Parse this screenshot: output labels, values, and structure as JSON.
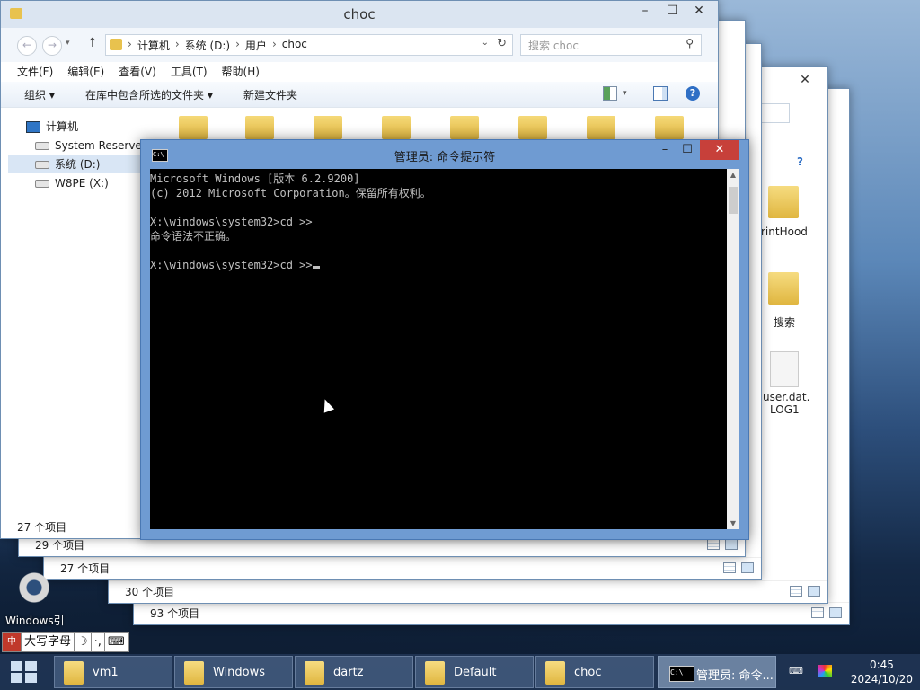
{
  "top_explorer": {
    "title": "choc",
    "breadcrumbs": [
      "计算机",
      "系统 (D:)",
      "用户",
      "choc"
    ],
    "search_placeholder": "搜索 choc",
    "menu": [
      "文件(F)",
      "编辑(E)",
      "查看(V)",
      "工具(T)",
      "帮助(H)"
    ],
    "commands": {
      "organize": "组织 ▾",
      "include_library": "在库中包含所选的文件夹 ▾",
      "new_folder": "新建文件夹"
    },
    "nav": {
      "computer": "计算机",
      "drives": [
        "System Reserved",
        "系统 (D:)",
        "W8PE (X:)"
      ]
    },
    "status": "27 个项目"
  },
  "back_windows": {
    "status": [
      "29 个项目",
      "27 个项目",
      "30 个项目",
      "93 个项目"
    ],
    "items": [
      "rintHood",
      "搜索",
      "user.dat.",
      "LOG1"
    ]
  },
  "cmd_window": {
    "title": "管理员: 命令提示符",
    "icon_label": "C:\\",
    "lines": [
      "Microsoft Windows [版本 6.2.9200]",
      "(c) 2012 Microsoft Corporation。保留所有权利。",
      "",
      "X:\\windows\\system32>cd >>",
      "命令语法不正确。",
      "",
      "X:\\windows\\system32>cd >>"
    ]
  },
  "desktop": {
    "gear_label": "Windows引"
  },
  "ime": {
    "mode": "大写字母",
    "moon": "☽",
    "punct": "·,",
    "keyboard": "⌨"
  },
  "taskbar": {
    "buttons": [
      "vm1",
      "Windows",
      "dartz",
      "Default",
      "choc"
    ],
    "cmd_button": "管理员: 命令...",
    "time": "0:45",
    "date": "2024/10/20"
  }
}
